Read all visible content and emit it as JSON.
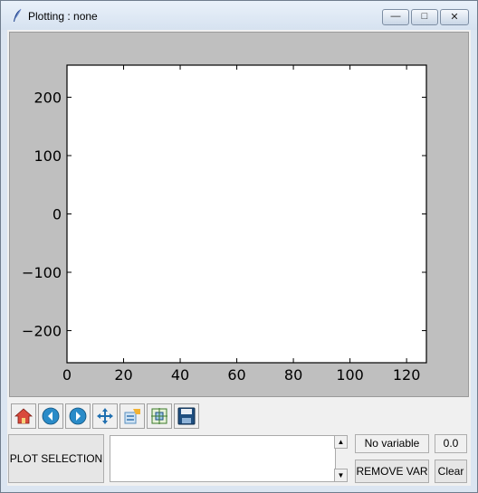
{
  "window": {
    "title": "Plotting : none",
    "controls": {
      "minimize": "minimize-icon",
      "maximize": "maximize-icon",
      "close": "close-icon"
    }
  },
  "chart_data": {
    "type": "line",
    "title": "",
    "xlabel": "",
    "ylabel": "",
    "xlim": [
      0,
      127
    ],
    "ylim": [
      -255,
      255
    ],
    "xticks": [
      "0",
      "20",
      "40",
      "60",
      "80",
      "100",
      "120"
    ],
    "yticks": [
      "200",
      "100",
      "0",
      "−100",
      "−200"
    ],
    "series": [],
    "grid": false
  },
  "toolbar": {
    "items": [
      {
        "icon": "home-icon"
      },
      {
        "icon": "back-icon"
      },
      {
        "icon": "forward-icon"
      },
      {
        "icon": "pan-icon"
      },
      {
        "icon": "configure-subplots-icon"
      },
      {
        "icon": "zoom-to-rect-icon"
      },
      {
        "icon": "save-icon"
      }
    ]
  },
  "controls": {
    "plot_selection_label": "PLOT SELECTION",
    "variable_label": "No variable",
    "value_label": "0.0",
    "remove_var_label": "REMOVE VAR",
    "clear_label": "Clear"
  },
  "colors": {
    "canvas_bg": "#bfbfbf",
    "axes_bg": "#ffffff"
  }
}
